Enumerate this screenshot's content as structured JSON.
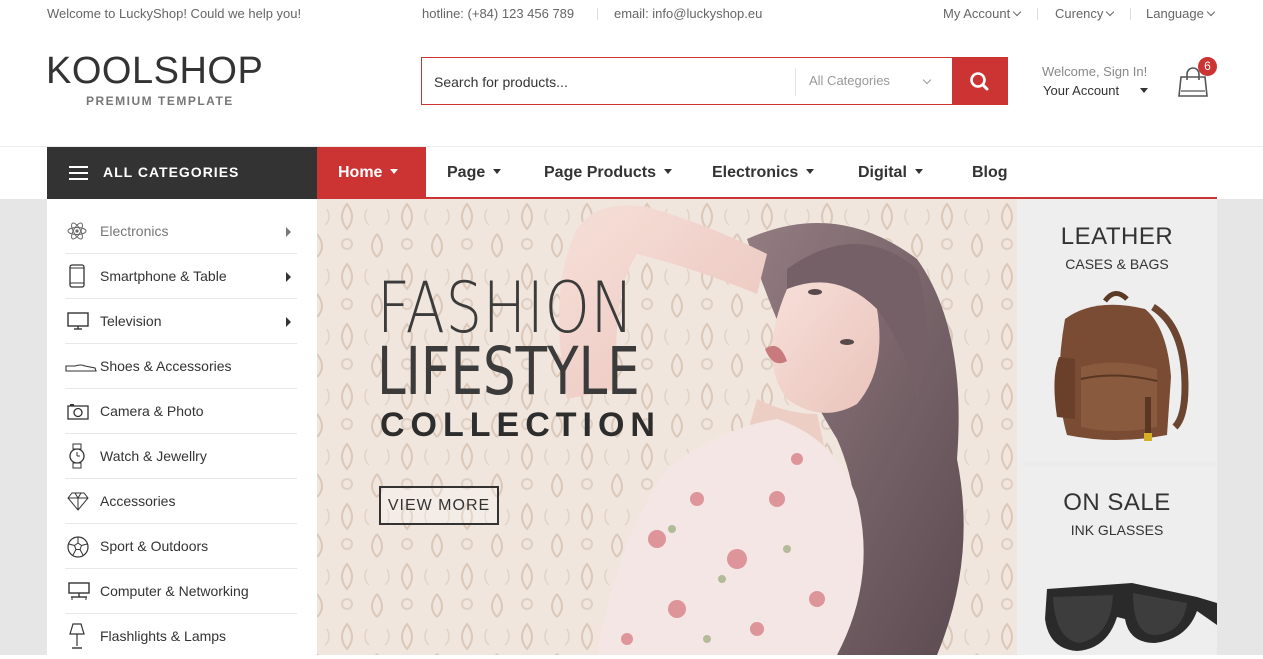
{
  "topbar": {
    "welcome": "Welcome to LuckyShop! Could we help you!",
    "hotline": "hotline: (+84) 123 456 789",
    "email": "email: info@luckyshop.eu",
    "my_account": "My Account",
    "currency": "Curency",
    "language": "Language"
  },
  "brand": {
    "name": "KOOLSHOP",
    "tagline": "PREMIUM TEMPLATE"
  },
  "search": {
    "placeholder": "Search for products...",
    "category": "All Categories",
    "icon": "search-icon"
  },
  "account": {
    "greeting": "Welcome, Sign In!",
    "label": "Your Account"
  },
  "cart": {
    "count": "6",
    "icon": "shopping-bag-icon"
  },
  "nav": {
    "all_categories": "ALL CATEGORIES",
    "items": [
      {
        "label": "Home",
        "active": true
      },
      {
        "label": "Page"
      },
      {
        "label": "Page Products"
      },
      {
        "label": "Electronics"
      },
      {
        "label": "Digital"
      },
      {
        "label": "Blog"
      }
    ]
  },
  "categories": [
    {
      "label": "Electronics",
      "icon": "atom-icon"
    },
    {
      "label": "Smartphone & Table",
      "icon": "smartphone-icon"
    },
    {
      "label": "Television",
      "icon": "television-icon"
    },
    {
      "label": "Shoes & Accessories",
      "icon": "shoe-icon"
    },
    {
      "label": "Camera & Photo",
      "icon": "camera-icon"
    },
    {
      "label": "Watch & Jewellry",
      "icon": "watch-icon"
    },
    {
      "label": "Accessories",
      "icon": "diamond-icon"
    },
    {
      "label": "Sport & Outdoors",
      "icon": "football-icon"
    },
    {
      "label": "Computer & Networking",
      "icon": "computer-icon"
    },
    {
      "label": "Flashlights & Lamps",
      "icon": "lamp-icon"
    }
  ],
  "banner": {
    "line1": "FASHION",
    "line2": "LIFESTYLE",
    "line3": "COLLECTION",
    "cta": "VIEW MORE"
  },
  "promos": [
    {
      "title": "LEATHER",
      "subtitle": "CASES & BAGS"
    },
    {
      "title": "ON SALE",
      "subtitle": "INK GLASSES"
    }
  ],
  "colors": {
    "accent": "#cc3333",
    "dark": "#333333"
  }
}
